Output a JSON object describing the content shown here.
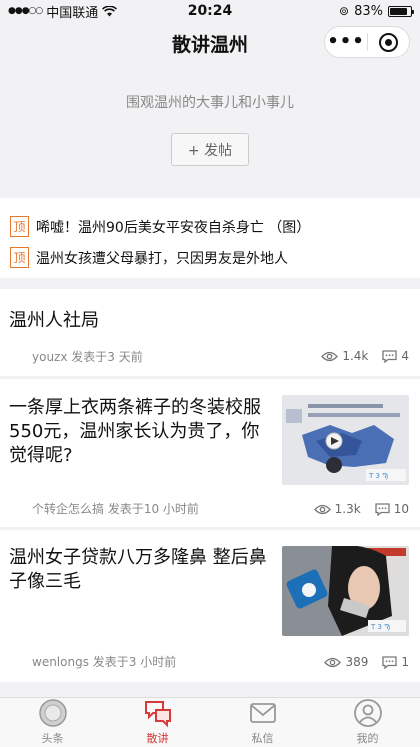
{
  "status_bar": {
    "carrier": "中国联通",
    "time": "20:24",
    "battery": "83%",
    "battery_level": 0.83
  },
  "nav": {
    "title": "散讲温州"
  },
  "header": {
    "slogan": "围观温州的大事儿和小事儿",
    "post_button": "+ 发帖"
  },
  "pinned": {
    "badge": "顶",
    "items": [
      {
        "text": "唏嘘！温州90后美女平安夜自杀身亡 （图）"
      },
      {
        "text": "温州女孩遭父母暴打，只因男友是外地人"
      }
    ]
  },
  "posts": [
    {
      "title": "温州人社局",
      "meta": "youzx 发表于3 天前",
      "views": "1.4k",
      "comments": "4"
    },
    {
      "title": "一条厚上衣两条裤子的冬装校服550元，温州家长认为贵了，你觉得呢?",
      "meta": "个转企怎么搞 发表于10 小时前",
      "views": "1.3k",
      "comments": "10"
    },
    {
      "title": "温州女子贷款八万多隆鼻 整后鼻子像三毛",
      "meta": "wenlongs 发表于3 小时前",
      "views": "389",
      "comments": "1"
    }
  ],
  "tabs": [
    {
      "label": "头条",
      "icon": "headlines-icon",
      "active": false
    },
    {
      "label": "散讲",
      "icon": "chat-icon",
      "active": true
    },
    {
      "label": "私信",
      "icon": "mail-icon",
      "active": false
    },
    {
      "label": "我的",
      "icon": "user-icon",
      "active": false
    }
  ],
  "colors": {
    "accent": "#d83a3a",
    "pin": "#e8772e",
    "background": "#f2f2f4"
  }
}
